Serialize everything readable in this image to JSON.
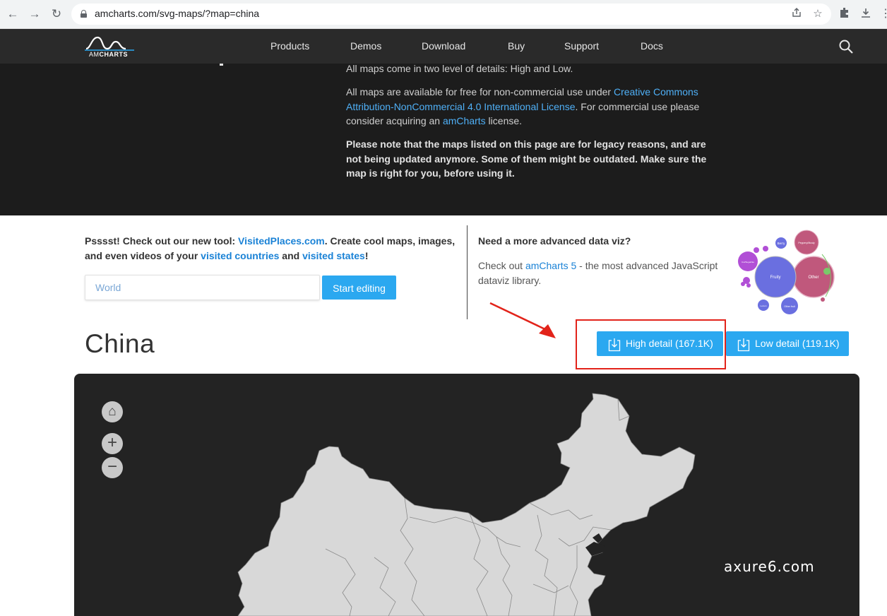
{
  "browser": {
    "url": "amcharts.com/svg-maps/?map=china",
    "back_icon": "←",
    "forward_icon": "→",
    "reload_icon": "↻"
  },
  "site": {
    "logo_am": "AM",
    "logo_charts": "CHARTS",
    "nav": [
      "Products",
      "Demos",
      "Download",
      "Buy",
      "Support",
      "Docs"
    ]
  },
  "hero": {
    "p1": "All maps come in two level of details: High and Low.",
    "p2_prefix": "All maps are available for free for non-commercial use under ",
    "p2_link": "Creative Commons Attribution-NonCommercial 4.0 International License",
    "p2_mid": ". For commercial use please consider acquiring an ",
    "p2_link2": "amCharts",
    "p2_suffix": " license.",
    "p3": "Please note that the maps listed on this page are for legacy reasons, and are not being updated anymore. Some of them might be outdated. Make sure the map is right for you, before using it."
  },
  "promo": {
    "prefix": "Psssst! Check out our new tool: ",
    "link1": "VisitedPlaces.com",
    "mid1": ". Create cool maps, images, and even videos of your ",
    "link2": "visited countries",
    "mid2": " and ",
    "link3": "visited states",
    "suffix": "!",
    "input_placeholder": "World",
    "start_button": "Start editing"
  },
  "advanced": {
    "title": "Need a more advanced data viz?",
    "prefix": "Check out ",
    "link": "amCharts 5",
    "suffix": " - the most advanced JavaScript dataviz library.",
    "bubble_labels": [
      "Fruity",
      "Other",
      "Berry",
      "Peppery/Musty",
      "Other fruit",
      "Cut/Sugarlike",
      "Lemon"
    ]
  },
  "page": {
    "title": "China",
    "high_detail": "High detail (167.1K)",
    "low_detail": "Low detail (119.1K)"
  },
  "map": {
    "home": "⌂",
    "zoom_in": "+",
    "zoom_out": "−"
  },
  "watermark": "axure6.com",
  "colors": {
    "accent": "#2ba8f0",
    "link": "#1a82d6",
    "annotation": "#e2231a",
    "map_fill": "#d8d8d8"
  }
}
